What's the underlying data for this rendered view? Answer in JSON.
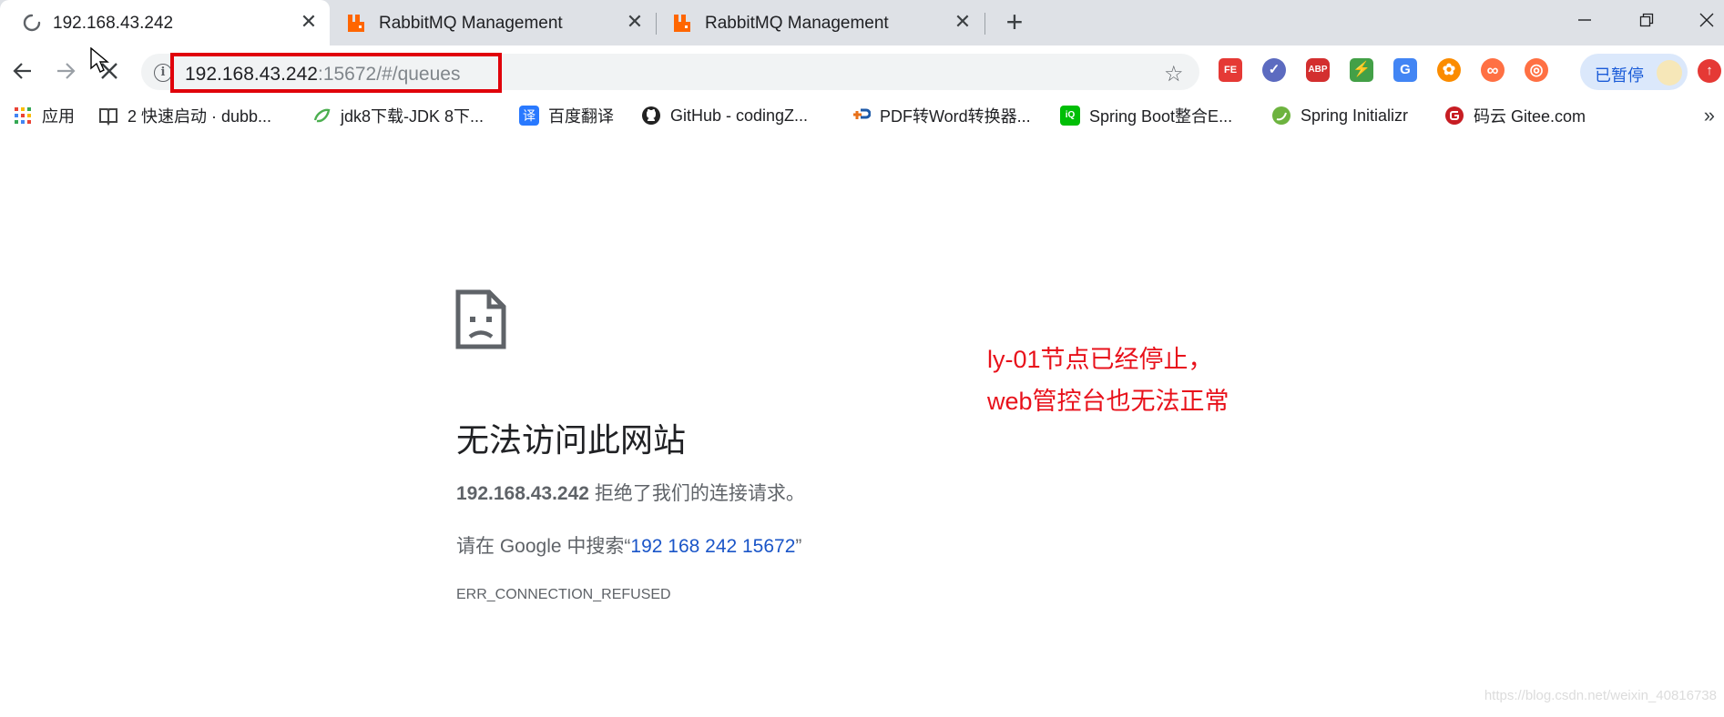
{
  "tabs": [
    {
      "title": "192.168.43.242",
      "icon": "loading-spinner-icon",
      "active": true
    },
    {
      "title": "RabbitMQ Management",
      "icon": "rabbitmq-icon",
      "active": false
    },
    {
      "title": "RabbitMQ Management",
      "icon": "rabbitmq-icon",
      "active": false
    }
  ],
  "window": {
    "new_tab": "+",
    "minimize": "—",
    "restore": "❐",
    "close": "✕"
  },
  "omnibox": {
    "host": "192.168.43.242",
    "path": ":15672/#/queues"
  },
  "extensions": [
    {
      "name": "fehelper-icon",
      "label": "FE",
      "color": "#e53935"
    },
    {
      "name": "task-check-icon",
      "label": "✓",
      "color": "#5c6bc0"
    },
    {
      "name": "adblock-plus-icon",
      "label": "ABP",
      "color": "#d32f2f"
    },
    {
      "name": "colorful-bolt-icon",
      "label": "⚡",
      "color": "#43a047"
    },
    {
      "name": "google-translate-icon",
      "label": "G",
      "color": "#4285f4"
    },
    {
      "name": "photos-pinwheel-icon",
      "label": "✿",
      "color": "#fb8c00"
    },
    {
      "name": "infinity-icon",
      "label": "∞",
      "color": "#ff7043"
    },
    {
      "name": "lifebuoy-icon",
      "label": "◎",
      "color": "#ff7043"
    }
  ],
  "profile": {
    "paused_label": "已暂停"
  },
  "bookmarks": [
    {
      "label": "应用",
      "icon": "apps-grid-icon"
    },
    {
      "label": "2 快速启动 · dubb...",
      "icon": "book-icon"
    },
    {
      "label": "jdk8下载-JDK 8下...",
      "icon": "green-leaf-icon"
    },
    {
      "label": "百度翻译",
      "icon": "baidu-translate-icon"
    },
    {
      "label": "GitHub - codingZ...",
      "icon": "github-icon"
    },
    {
      "label": "PDF转Word转换器...",
      "icon": "pdf-convert-icon"
    },
    {
      "label": "Spring Boot整合E...",
      "icon": "iqiyi-icon"
    },
    {
      "label": "Spring Initializr",
      "icon": "spring-icon"
    },
    {
      "label": "码云 Gitee.com",
      "icon": "gitee-icon"
    }
  ],
  "error": {
    "title": "无法访问此网站",
    "host": "192.168.43.242",
    "refused_text": " 拒绝了我们的连接请求。",
    "search_prefix": "请在 Google 中搜索“",
    "search_query": "192 168 242 15672",
    "search_suffix": "”",
    "code": "ERR_CONNECTION_REFUSED"
  },
  "annotation": {
    "line1": "ly-01节点已经停止，",
    "line2": "web管控台也无法正常"
  },
  "watermark": "https://blog.csdn.net/weixin_40816738"
}
